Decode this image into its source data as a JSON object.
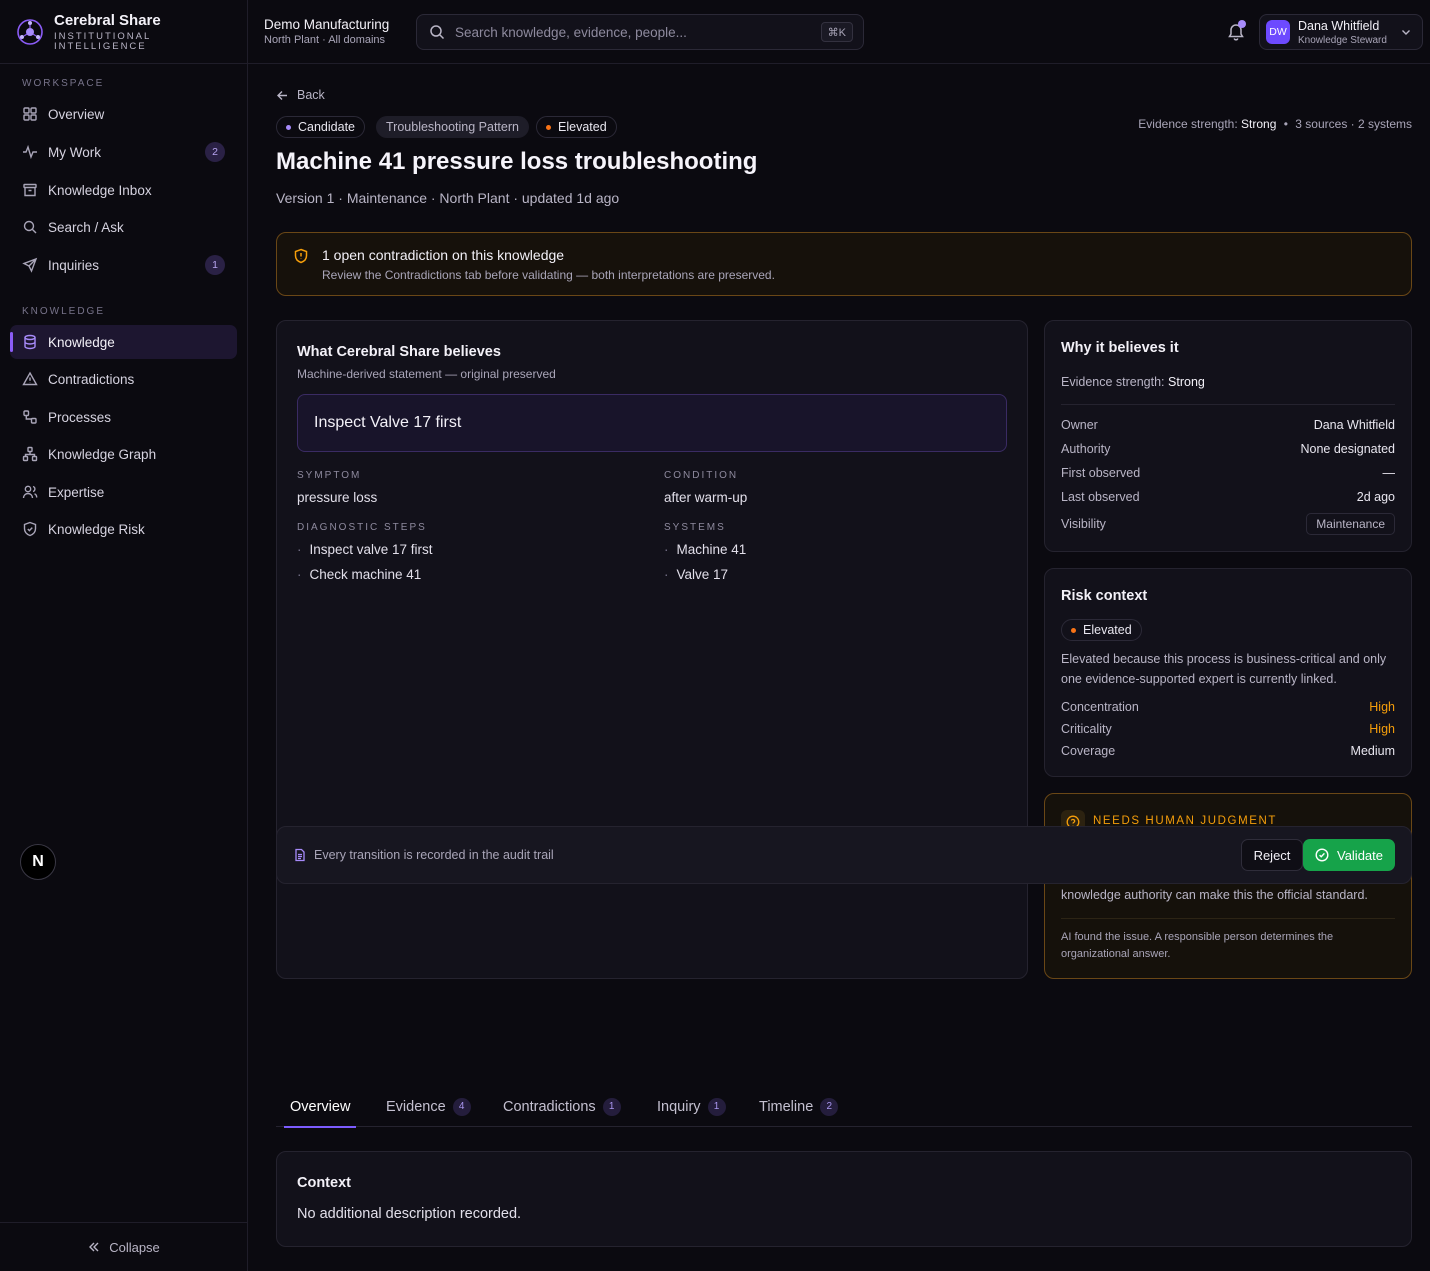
{
  "brand": {
    "name": "Cerebral Share",
    "tagline_1": "INSTITUTIONAL",
    "tagline_2": "INTELLIGENCE"
  },
  "sidebar": {
    "section_workspace": "WORKSPACE",
    "section_knowledge": "KNOWLEDGE",
    "items": [
      {
        "label": "Overview",
        "icon": "grid-icon"
      },
      {
        "label": "My Work",
        "icon": "activity-icon",
        "badge": "2"
      },
      {
        "label": "Knowledge Inbox",
        "icon": "archive-icon"
      },
      {
        "label": "Search / Ask",
        "icon": "search-icon"
      },
      {
        "label": "Inquiries",
        "icon": "send-icon",
        "badge": "1"
      },
      {
        "label": "Knowledge",
        "icon": "database-icon",
        "active": true
      },
      {
        "label": "Contradictions",
        "icon": "warning-triangle-icon"
      },
      {
        "label": "Processes",
        "icon": "workflow-icon"
      },
      {
        "label": "Knowledge Graph",
        "icon": "graph-icon"
      },
      {
        "label": "Expertise",
        "icon": "users-icon"
      },
      {
        "label": "Knowledge Risk",
        "icon": "shield-icon"
      }
    ],
    "avatar_letter": "N",
    "collapse_label": "Collapse"
  },
  "topbar": {
    "org_name": "Demo Manufacturing",
    "org_scope": "North Plant · All domains",
    "search_placeholder": "Search knowledge, evidence, people...",
    "search_shortcut": "⌘K",
    "user_initials": "DW",
    "user_name": "Dana Whitfield",
    "user_role": "Knowledge Steward"
  },
  "page": {
    "back_label": "Back",
    "chip_status": "Candidate",
    "chip_type": "Troubleshooting Pattern",
    "chip_risk": "Elevated",
    "evidence_prefix": "Evidence strength:",
    "evidence_value": "Strong",
    "evidence_rest": "3 sources · 2 systems",
    "title": "Machine 41 pressure loss troubleshooting",
    "meta": "Version 1 · Maintenance · North Plant · updated 1d ago"
  },
  "alert": {
    "title": "1 open contradiction on this knowledge",
    "body": "Review the Contradictions tab before validating — both interpretations are preserved."
  },
  "believes": {
    "heading": "What Cerebral Share believes",
    "subheading": "Machine-derived statement — original preserved",
    "statement": "Inspect Valve 17 first",
    "symptom_label": "SYMPTOM",
    "symptom": "pressure loss",
    "condition_label": "CONDITION",
    "condition": "after warm-up",
    "steps_label": "DIAGNOSTIC STEPS",
    "steps": [
      "Inspect valve 17 first",
      "Check machine 41"
    ],
    "systems_label": "SYSTEMS",
    "systems": [
      "Machine 41",
      "Valve 17"
    ]
  },
  "why": {
    "heading": "Why it believes it",
    "strength_prefix": "Evidence strength:",
    "strength_value": "Strong",
    "rows": [
      {
        "k": "Owner",
        "v": "Dana Whitfield"
      },
      {
        "k": "Authority",
        "v": "None designated"
      },
      {
        "k": "First observed",
        "v": "—"
      },
      {
        "k": "Last observed",
        "v": "2d ago"
      }
    ],
    "visibility_label": "Visibility",
    "visibility_value": "Maintenance"
  },
  "risk": {
    "heading": "Risk context",
    "chip": "Elevated",
    "description": "Elevated because this process is business-critical and only one evidence-supported expert is currently linked.",
    "rows": [
      {
        "k": "Concentration",
        "v": "High",
        "color": "#f59e0b"
      },
      {
        "k": "Criticality",
        "v": "High",
        "color": "#f59e0b"
      },
      {
        "k": "Coverage",
        "v": "Medium",
        "color": "#e8e6ef"
      }
    ]
  },
  "judgment": {
    "heading": "NEEDS HUMAN JUDGMENT",
    "body": "knowledge authority can make this the official standard.",
    "footer": "AI found the issue. A responsible person determines the organizational answer."
  },
  "actionbar": {
    "note": "Every transition is recorded in the audit trail",
    "reject_label": "Reject",
    "validate_label": "Validate"
  },
  "tabs": [
    {
      "label": "Overview",
      "active": true
    },
    {
      "label": "Evidence",
      "badge": "4"
    },
    {
      "label": "Contradictions",
      "badge": "1"
    },
    {
      "label": "Inquiry",
      "badge": "1"
    },
    {
      "label": "Timeline",
      "badge": "2"
    }
  ],
  "context": {
    "heading": "Context",
    "body": "No additional description recorded."
  },
  "colors": {
    "accent": "#8b5cf6",
    "validate": "#16a34a",
    "warning": "#f59e0b",
    "risk_dot": "#f97316"
  }
}
